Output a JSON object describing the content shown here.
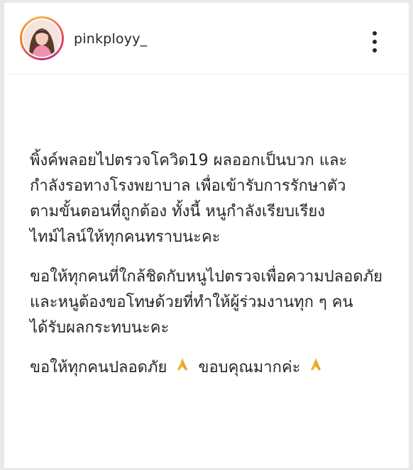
{
  "post": {
    "username": "pinkployy_",
    "caption_lines": [
      [
        "พิ้งค์พลอยไปตรวจโควิด19 ผลออกเป็นบวก และ",
        "กำลังรอทางโรงพยาบาล เพื่อเข้ารับการรักษาตัว",
        "ตามขั้นตอนที่ถูกต้อง  ทั้งนี้ หนูกำลังเรียบเรียง",
        "ไทม์ไลน์ให้ทุกคนทราบนะคะ"
      ],
      [
        "ขอให้ทุกคนที่ใกล้ชิดกับหนูไปตรวจเพื่อความปลอดภัย",
        "และหนูต้องขอโทษด้วยที่ทำให้ผู้ร่วมงานทุก ๆ คน",
        "ได้รับผลกระทบนะคะ"
      ]
    ],
    "closing": {
      "text1": "ขอให้ทุกคนปลอดภัย",
      "text2": "ขอบคุณมากค่ะ",
      "emoji": "folded-hands-emoji"
    }
  },
  "icons": {
    "more": "more-vertical-icon",
    "avatar": "profile-photo"
  },
  "colors": {
    "text": "#262626",
    "background": "#ffffff",
    "page": "#e9e9e9",
    "emoji": "#f2b43a",
    "story_ring": "#e8415f"
  }
}
